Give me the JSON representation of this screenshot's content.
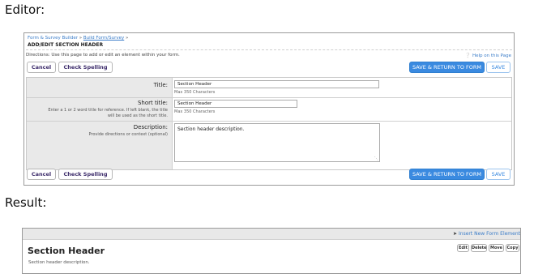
{
  "captions": {
    "editor": "Editor:",
    "result": "Result:"
  },
  "editor": {
    "breadcrumb": [
      "Form & Survey Builder",
      "Build Form/Survey"
    ],
    "breadcrumb_sep": "»",
    "page_title": "ADD/EDIT SECTION HEADER",
    "directions": "Directions: Use this page to add or edit an element within your form.",
    "help_link": "Help on this Page",
    "buttons": {
      "cancel": "Cancel",
      "check_spelling": "Check Spelling",
      "save_return": "SAVE & RETURN TO FORM",
      "save": "SAVE"
    },
    "fields": {
      "title_label": "Title:",
      "title_value": "Section Header",
      "title_note": "Max 350 Characters",
      "short_title_label": "Short title:",
      "short_title_hint": [
        "Enter a 1 or 2 word title for reference. If left blank, the title",
        "will be used as the short title."
      ],
      "short_title_value": "Section Header",
      "short_title_note": "Max 350 Characters",
      "description_label": "Description:",
      "description_hint": "Provide directions or context (optional)",
      "description_value": "Section header description."
    }
  },
  "result": {
    "insert_link": "Insert New Form Element",
    "section_title": "Section Header",
    "section_description": "Section header description.",
    "actions": [
      "Edit",
      "Delete",
      "Move",
      "Copy"
    ]
  }
}
